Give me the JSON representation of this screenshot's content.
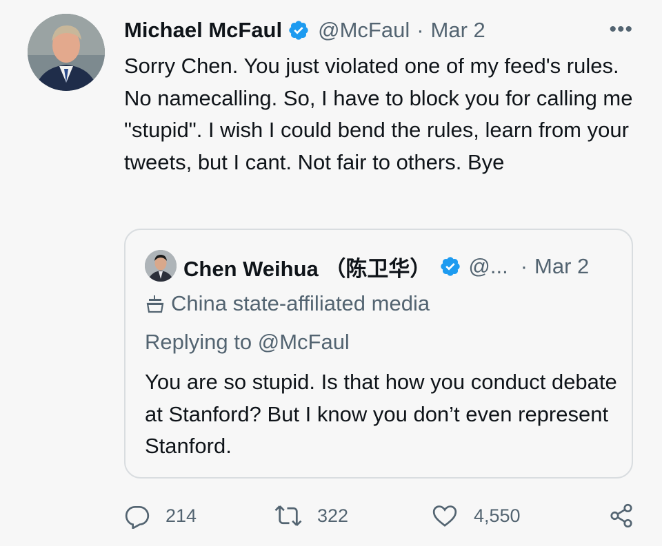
{
  "tweet": {
    "author_name": "Michael McFaul",
    "handle": "@McFaul",
    "separator": "·",
    "date": "Mar 2",
    "more_label": "•••",
    "text": "Sorry Chen. You just violated one of my feed's rules. No namecalling. So, I have to block you for calling me \"stupid\". I wish I could bend the rules, learn from your tweets, but I cant. Not fair to others. Bye"
  },
  "quote": {
    "author_name": "Chen Weihua （陈卫华）",
    "handle": "@...",
    "separator": "·",
    "date": "Mar 2",
    "media_label": "China state-affiliated media",
    "replying_prefix": "Replying to ",
    "replying_handle": "@McFaul",
    "text": "You are so stupid. Is that how you conduct debate at Stanford? But I know you don’t even represent Stanford."
  },
  "actions": {
    "replies": "214",
    "retweets": "322",
    "likes": "4,550"
  },
  "colors": {
    "verified_blue": "#1d9bf0",
    "secondary_text": "#536471",
    "primary_text": "#0f1419",
    "border": "#d9dde0"
  },
  "icons": [
    "verified-badge-icon",
    "more-icon",
    "state-media-icon",
    "reply-icon",
    "retweet-icon",
    "like-icon",
    "share-icon"
  ]
}
